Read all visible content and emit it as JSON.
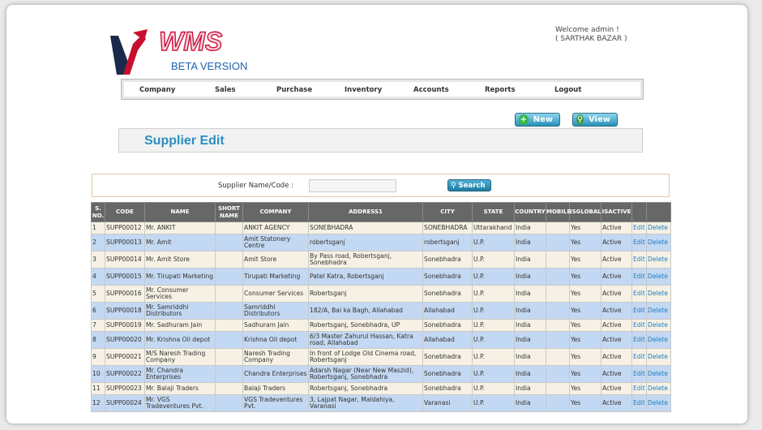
{
  "header": {
    "logo_text": "WMS",
    "logo_sub": "BETA VERSION",
    "welcome_line1": "Welcome admin !",
    "welcome_line2": "( SARTHAK BAZAR )"
  },
  "nav": [
    {
      "label": "Company"
    },
    {
      "label": "Sales"
    },
    {
      "label": "Purchase"
    },
    {
      "label": "Inventory"
    },
    {
      "label": "Accounts"
    },
    {
      "label": "Reports"
    },
    {
      "label": "Logout"
    }
  ],
  "toolbar": {
    "new_label": "New",
    "view_label": "View"
  },
  "page_title": "Supplier Edit",
  "search": {
    "label": "Supplier Name/Code :",
    "value": "",
    "button_label": "Search"
  },
  "table": {
    "columns": [
      "S. NO.",
      "CODE",
      "NAME",
      "SHORT NAME",
      "COMPANY",
      "ADDRESS1",
      "CITY",
      "STATE",
      "COUNTRY",
      "MOBILE",
      "ISGLOBAL",
      "ISACTIVE",
      "",
      ""
    ],
    "edit_label": "Edit",
    "delete_label": "Delete",
    "rows": [
      {
        "sno": "1",
        "code": "SUPP00012",
        "name": "Mr. ANKIT",
        "short": "",
        "company": "ANKIT AGENCY",
        "address": "SONEBHADRA",
        "city": "SONEBHADRA",
        "state": "Uttarakhand",
        "country": "India",
        "mobile": "",
        "isglobal": "Yes",
        "isactive": "Active"
      },
      {
        "sno": "2",
        "code": "SUPP00013",
        "name": "Mr. Amit",
        "short": "",
        "company": "Amit Statonery Centre",
        "address": "robertsganj",
        "city": "robertsganj",
        "state": "U.P.",
        "country": "India",
        "mobile": "",
        "isglobal": "Yes",
        "isactive": "Active"
      },
      {
        "sno": "3",
        "code": "SUPP00014",
        "name": "Mr. Amit Store",
        "short": "",
        "company": "Amit Store",
        "address": "By Pass road, Robertsganj, Sonebhadra",
        "city": "Sonebhadra",
        "state": "U.P.",
        "country": "India",
        "mobile": "",
        "isglobal": "Yes",
        "isactive": "Active"
      },
      {
        "sno": "4",
        "code": "SUPP00015",
        "name": "Mr. Tirupati Marketing",
        "short": "",
        "company": "Tirupati Marketing",
        "address": "Patel Katra, Robertsganj",
        "city": "Sonebhadra",
        "state": "U.P.",
        "country": "India",
        "mobile": "",
        "isglobal": "Yes",
        "isactive": "Active"
      },
      {
        "sno": "5",
        "code": "SUPP00016",
        "name": "Mr. Consumer Services",
        "short": "",
        "company": "Consumer Services",
        "address": "Robertsganj",
        "city": "Sonebhadra",
        "state": "U.P.",
        "country": "India",
        "mobile": "",
        "isglobal": "Yes",
        "isactive": "Active"
      },
      {
        "sno": "6",
        "code": "SUPP00018",
        "name": "Mr. Samriddhi Distributors",
        "short": "",
        "company": "Samriddhi Distributors",
        "address": "182/A, Bai ka Bagh, Allahabad",
        "city": "Allahabad",
        "state": "U.P.",
        "country": "India",
        "mobile": "",
        "isglobal": "Yes",
        "isactive": "Active"
      },
      {
        "sno": "7",
        "code": "SUPP00019",
        "name": "Mr. Sadhuram Jain",
        "short": "",
        "company": "Sadhuram Jain",
        "address": "Robertsganj, Sonebhadra, UP",
        "city": "Sonebhadra",
        "state": "U.P.",
        "country": "India",
        "mobile": "",
        "isglobal": "Yes",
        "isactive": "Active"
      },
      {
        "sno": "8",
        "code": "SUPP00020",
        "name": "Mr. Krishna Oil depot",
        "short": "",
        "company": "Krishna Oil depot",
        "address": "6/3 Master Zahurul Hassan, Katra road, Allahabad",
        "city": "Allahabad",
        "state": "U.P.",
        "country": "India",
        "mobile": "",
        "isglobal": "Yes",
        "isactive": "Active"
      },
      {
        "sno": "9",
        "code": "SUPP00021",
        "name": "M/S Naresh Trading Company",
        "short": "",
        "company": "Naresh Trading Company",
        "address": "In front of Lodge Old Cinema road, Robertsganj",
        "city": "Sonebhadra",
        "state": "U.P.",
        "country": "India",
        "mobile": "",
        "isglobal": "Yes",
        "isactive": "Active"
      },
      {
        "sno": "10",
        "code": "SUPP00022",
        "name": "Mr. Chandra Enterprises",
        "short": "",
        "company": "Chandra Enterprises",
        "address": "Adarsh Nagar (Near New Maszid), Robertsganj, Sonebhadra",
        "city": "Sonebhadra",
        "state": "U.P.",
        "country": "India",
        "mobile": "",
        "isglobal": "Yes",
        "isactive": "Active"
      },
      {
        "sno": "11",
        "code": "SUPP00023",
        "name": "Mr. Balaji Traders",
        "short": "",
        "company": "Balaji Traders",
        "address": "Robertsganj, Sonebhadra",
        "city": "Sonebhadra",
        "state": "U.P.",
        "country": "India",
        "mobile": "",
        "isglobal": "Yes",
        "isactive": "Active"
      },
      {
        "sno": "12",
        "code": "SUPP00024",
        "name": "Mr. VGS Tradeventures Pvt.",
        "short": "",
        "company": "VGS Tradeventures Pvt.",
        "address": "3, Lajpat Nagar, Maldahiya, Varanasi",
        "city": "Varanasi",
        "state": "U.P.",
        "country": "India",
        "mobile": "",
        "isglobal": "Yes",
        "isactive": "Active"
      }
    ]
  }
}
